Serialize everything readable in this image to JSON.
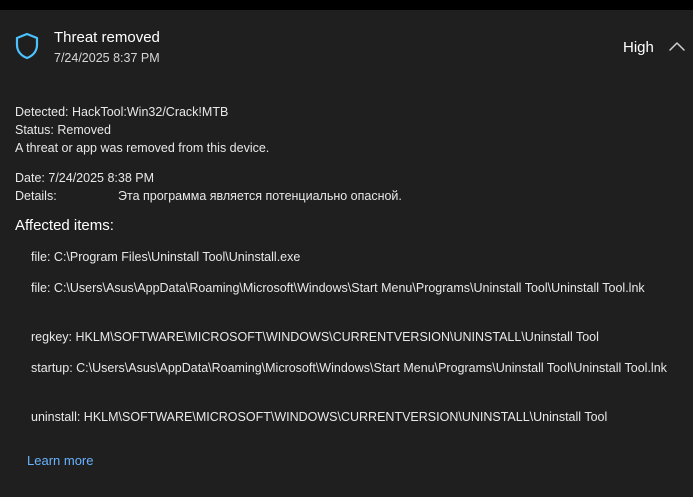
{
  "notification": {
    "title": "Threat removed",
    "timestamp": "7/24/2025 8:37 PM",
    "severity": "High",
    "icons": {
      "shield": "shield-icon",
      "chevron": "chevron-up-icon"
    }
  },
  "info": {
    "detected_label": "Detected:",
    "detected_value": "HackTool:Win32/Crack!MTB",
    "status_label": "Status:",
    "status_value": "Removed",
    "message": "A threat or app was removed from this device.",
    "date_label": "Date:",
    "date_value": "7/24/2025 8:38 PM",
    "details_label": "Details:",
    "details_value": "Эта программа является потенциально опасной."
  },
  "affected": {
    "title": "Affected items:",
    "items": [
      "file: C:\\Program Files\\Uninstall Tool\\Uninstall.exe",
      "file: C:\\Users\\Asus\\AppData\\Roaming\\Microsoft\\Windows\\Start Menu\\Programs\\Uninstall Tool\\Uninstall Tool.lnk",
      "regkey: HKLM\\SOFTWARE\\MICROSOFT\\WINDOWS\\CURRENTVERSION\\UNINSTALL\\Uninstall Tool",
      "startup: C:\\Users\\Asus\\AppData\\Roaming\\Microsoft\\Windows\\Start Menu\\Programs\\Uninstall Tool\\Uninstall Tool.lnk",
      "uninstall: HKLM\\SOFTWARE\\MICROSOFT\\WINDOWS\\CURRENTVERSION\\UNINSTALL\\Uninstall Tool"
    ]
  },
  "links": {
    "learn_more": "Learn more"
  },
  "colors": {
    "panel_bg": "#1f1f1f",
    "outer_bg": "#000000",
    "accent_link": "#6ab3ff",
    "shield_stroke": "#4cc2ff"
  }
}
